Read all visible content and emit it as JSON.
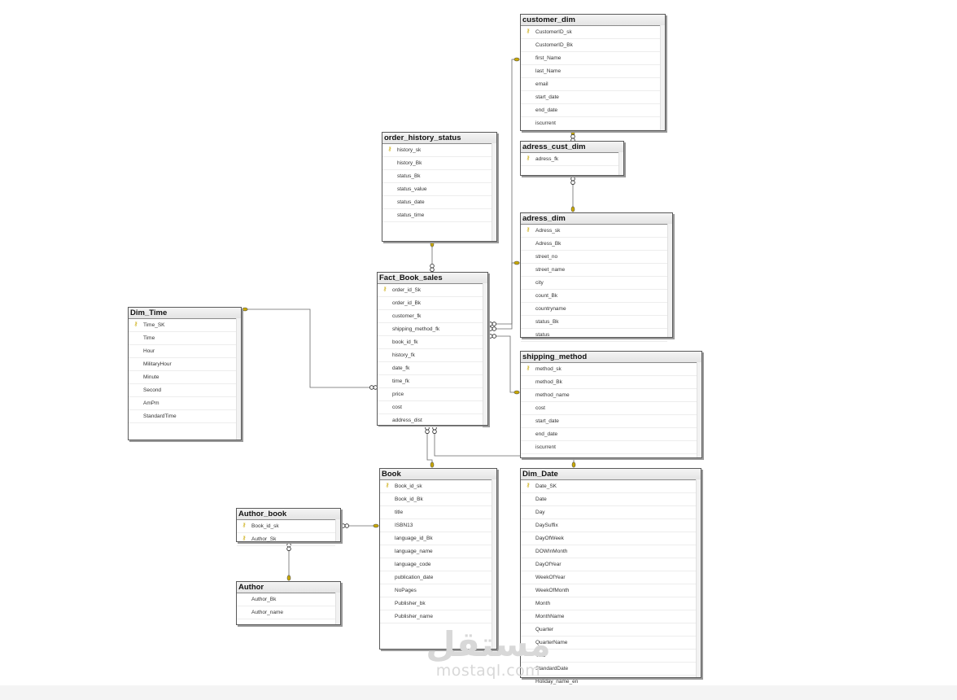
{
  "diagram": {
    "tables": [
      {
        "id": "customer_dim",
        "title": "customer_dim",
        "columns": [
          {
            "name": "CustomerID_sk",
            "key": true
          },
          {
            "name": "CustomerID_Bk"
          },
          {
            "name": "first_Name"
          },
          {
            "name": "last_Name"
          },
          {
            "name": "email"
          },
          {
            "name": "start_date"
          },
          {
            "name": "end_date"
          },
          {
            "name": "iscurrent"
          }
        ]
      },
      {
        "id": "adress_cust_dim",
        "title": "adress_cust_dim",
        "columns": [
          {
            "name": "adress_fk",
            "key": true
          }
        ]
      },
      {
        "id": "adress_dim",
        "title": "adress_dim",
        "columns": [
          {
            "name": "Adress_sk",
            "key": true
          },
          {
            "name": "Adress_Bk"
          },
          {
            "name": "street_no"
          },
          {
            "name": "street_name"
          },
          {
            "name": "city"
          },
          {
            "name": "count_Bk"
          },
          {
            "name": "countryname"
          },
          {
            "name": "status_Bk"
          },
          {
            "name": "status"
          }
        ]
      },
      {
        "id": "order_history_status",
        "title": "order_history_status",
        "columns": [
          {
            "name": "history_sk",
            "key": true
          },
          {
            "name": "history_Bk"
          },
          {
            "name": "status_Bk"
          },
          {
            "name": "status_value"
          },
          {
            "name": "status_date"
          },
          {
            "name": "status_time"
          }
        ]
      },
      {
        "id": "Fact_Book_sales",
        "title": "Fact_Book_sales",
        "columns": [
          {
            "name": "order_id_Sk",
            "key": true
          },
          {
            "name": "order_id_Bk"
          },
          {
            "name": "customer_fk"
          },
          {
            "name": "shipping_method_fk"
          },
          {
            "name": "book_id_fk"
          },
          {
            "name": "history_fk"
          },
          {
            "name": "date_fk"
          },
          {
            "name": "time_fk"
          },
          {
            "name": "price"
          },
          {
            "name": "cost"
          },
          {
            "name": "address_dist"
          }
        ]
      },
      {
        "id": "Dim_Time",
        "title": "Dim_Time",
        "columns": [
          {
            "name": "Time_SK",
            "key": true
          },
          {
            "name": "Time"
          },
          {
            "name": "Hour"
          },
          {
            "name": "MilitaryHour"
          },
          {
            "name": "Minute"
          },
          {
            "name": "Second"
          },
          {
            "name": "AmPm"
          },
          {
            "name": "StandardTime"
          }
        ]
      },
      {
        "id": "shipping_method",
        "title": "shipping_method",
        "columns": [
          {
            "name": "method_sk",
            "key": true
          },
          {
            "name": "method_Bk"
          },
          {
            "name": "method_name"
          },
          {
            "name": "cost"
          },
          {
            "name": "start_date"
          },
          {
            "name": "end_date"
          },
          {
            "name": "iscurrent"
          }
        ]
      },
      {
        "id": "Book",
        "title": "Book",
        "columns": [
          {
            "name": "Book_id_sk",
            "key": true
          },
          {
            "name": "Book_id_Bk"
          },
          {
            "name": "title"
          },
          {
            "name": "ISBN13"
          },
          {
            "name": "language_id_Bk"
          },
          {
            "name": "language_name"
          },
          {
            "name": "language_code"
          },
          {
            "name": "publication_date"
          },
          {
            "name": "NoPages"
          },
          {
            "name": "Publisher_bk"
          },
          {
            "name": "Publisher_name"
          }
        ]
      },
      {
        "id": "Dim_Date",
        "title": "Dim_Date",
        "columns": [
          {
            "name": "Date_SK",
            "key": true
          },
          {
            "name": "Date"
          },
          {
            "name": "Day"
          },
          {
            "name": "DaySuffix"
          },
          {
            "name": "DayOfWeek"
          },
          {
            "name": "DOWInMonth"
          },
          {
            "name": "DayOfYear"
          },
          {
            "name": "WeekOfYear"
          },
          {
            "name": "WeekOfMonth"
          },
          {
            "name": "Month"
          },
          {
            "name": "MonthName"
          },
          {
            "name": "Quarter"
          },
          {
            "name": "QuarterName"
          },
          {
            "name": "Year"
          },
          {
            "name": "StandardDate"
          },
          {
            "name": "Holiday_name_en"
          }
        ]
      },
      {
        "id": "Author_book",
        "title": "Author_book",
        "columns": [
          {
            "name": "Book_id_sk",
            "key": true
          },
          {
            "name": "Author_Sk",
            "key": true
          }
        ]
      },
      {
        "id": "Author",
        "title": "Author",
        "columns": [
          {
            "name": "Author_Bk"
          },
          {
            "name": "Author_name"
          }
        ]
      }
    ],
    "relationships": [
      {
        "from": "Fact_Book_sales",
        "to": "order_history_status"
      },
      {
        "from": "Fact_Book_sales",
        "to": "Dim_Time"
      },
      {
        "from": "Fact_Book_sales",
        "to": "customer_dim"
      },
      {
        "from": "Fact_Book_sales",
        "to": "adress_dim"
      },
      {
        "from": "Fact_Book_sales",
        "to": "shipping_method"
      },
      {
        "from": "Fact_Book_sales",
        "to": "Book"
      },
      {
        "from": "Fact_Book_sales",
        "to": "Dim_Date"
      },
      {
        "from": "adress_cust_dim",
        "to": "customer_dim"
      },
      {
        "from": "adress_cust_dim",
        "to": "adress_dim"
      },
      {
        "from": "Author_book",
        "to": "Book"
      },
      {
        "from": "Author_book",
        "to": "Author"
      }
    ]
  },
  "watermark": {
    "arabic": "مستقل",
    "latin": "mostaql.com"
  },
  "colors": {
    "key_icon": "#c9a800",
    "border": "#5a5a5a",
    "line": "#6a6a6a"
  }
}
